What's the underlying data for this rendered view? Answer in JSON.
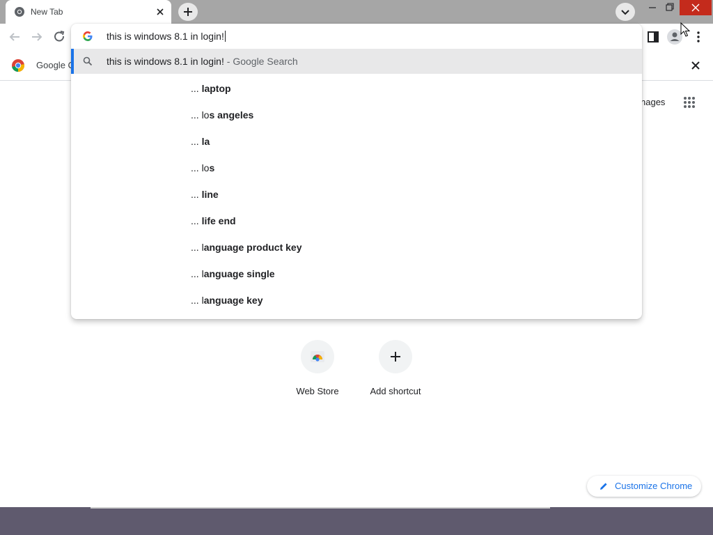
{
  "tab": {
    "title": "New Tab"
  },
  "omnibox": {
    "text": "this is windows 8.1 in login!",
    "selected_suggestion": "this is windows 8.1 in login!",
    "selected_suffix": " - Google Search",
    "suggestions": [
      {
        "prefix": "... ",
        "plain": "",
        "bold": "laptop"
      },
      {
        "prefix": "... ",
        "plain": "lo",
        "bold": "s angeles"
      },
      {
        "prefix": "... ",
        "plain": "",
        "bold": "la"
      },
      {
        "prefix": "... ",
        "plain": "lo",
        "bold": "s"
      },
      {
        "prefix": "... ",
        "plain": "",
        "bold": "line"
      },
      {
        "prefix": "... ",
        "plain": "",
        "bold": "life end"
      },
      {
        "prefix": "... ",
        "plain": "l",
        "bold": "anguage product key"
      },
      {
        "prefix": "... ",
        "plain": "l",
        "bold": "anguage single"
      },
      {
        "prefix": "... ",
        "plain": "l",
        "bold": "anguage key"
      }
    ]
  },
  "bookmarks": {
    "item_label": "Google C"
  },
  "ntp": {
    "images_link": "nages",
    "shortcuts": [
      {
        "label": "Web Store",
        "icon": "chrome-web-store-icon"
      },
      {
        "label": "Add shortcut",
        "icon": "plus-icon"
      }
    ],
    "customize_label": "Customize Chrome"
  },
  "colors": {
    "accent": "#1a73e8",
    "close_red": "#c42b1c",
    "tabstrip": "#a6a6a6"
  }
}
